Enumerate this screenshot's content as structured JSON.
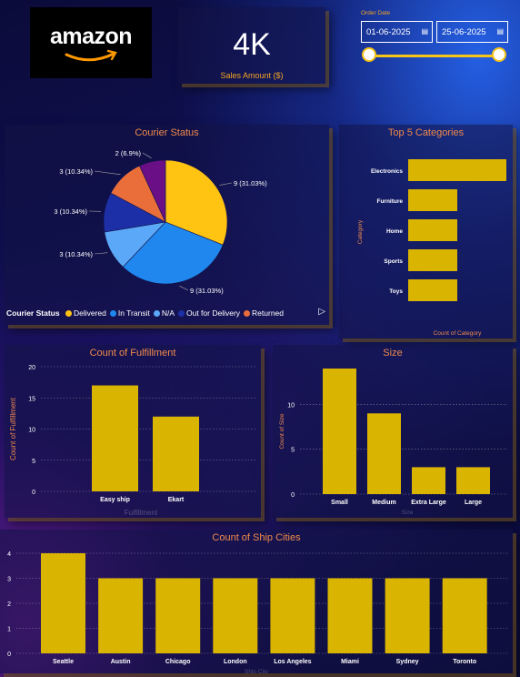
{
  "kpi": {
    "value": "4K",
    "label": "Sales Amount ($)"
  },
  "filter": {
    "label": "Order Date",
    "start": "01-06-2025",
    "end": "25-06-2025"
  },
  "logo": {
    "text": "amazon"
  },
  "colors": {
    "bar": "#d9b400",
    "title": "#f08a4b",
    "axis_label": "#f08a4b"
  },
  "chart_data": [
    {
      "type": "pie",
      "title": "Courier Status",
      "legend_title": "Courier Status",
      "categories": [
        "Delivered",
        "In Transit",
        "N/A",
        "Out for Delivery",
        "Returned",
        ""
      ],
      "values": [
        9,
        9,
        3,
        3,
        3,
        2
      ],
      "labels": [
        "9 (31.03%)",
        "9 (31.03%)",
        "3 (10.34%)",
        "3 (10.34%)",
        "3 (10.34%)",
        "2 (6.9%)"
      ],
      "colors": [
        "#ffc311",
        "#1f87ee",
        "#5aa8f7",
        "#1c2fa6",
        "#e96e3a",
        "#6a0f86"
      ],
      "legend": [
        "Delivered",
        "In Transit",
        "N/A",
        "Out for Delivery",
        "Returned"
      ]
    },
    {
      "type": "bar",
      "orientation": "horizontal",
      "title": "Top 5 Categories",
      "categories": [
        "Electronics",
        "Furniture",
        "Home",
        "Sports",
        "Toys"
      ],
      "values": [
        10,
        5,
        5,
        5,
        5
      ],
      "xlabel": "Count of Category",
      "ylabel": "Category"
    },
    {
      "type": "bar",
      "title": "Count of Fulfillment",
      "categories": [
        "Easy ship",
        "Ekart"
      ],
      "values": [
        17,
        12
      ],
      "ylabel": "Count of Fulfillment",
      "xlabel": "Fulfillment",
      "ylim": [
        0,
        20
      ],
      "yticks": [
        0,
        5,
        10,
        15,
        20
      ]
    },
    {
      "type": "bar",
      "title": "Size",
      "categories": [
        "Small",
        "Medium",
        "Extra Large",
        "Large"
      ],
      "values": [
        14,
        9,
        3,
        3
      ],
      "ylabel": "Count of Size",
      "xlabel": "Size",
      "ylim": [
        0,
        14
      ],
      "yticks": [
        0,
        5,
        10
      ]
    },
    {
      "type": "bar",
      "title": "Count of Ship Cities",
      "categories": [
        "Seattle",
        "Austin",
        "Chicago",
        "London",
        "Los Angeles",
        "Miami",
        "Sydney",
        "Toronto"
      ],
      "values": [
        4,
        3,
        3,
        3,
        3,
        3,
        3,
        3
      ],
      "ylim": [
        0,
        4
      ],
      "yticks": [
        0,
        1,
        2,
        3,
        4
      ],
      "xlabel": "Ship City"
    }
  ]
}
